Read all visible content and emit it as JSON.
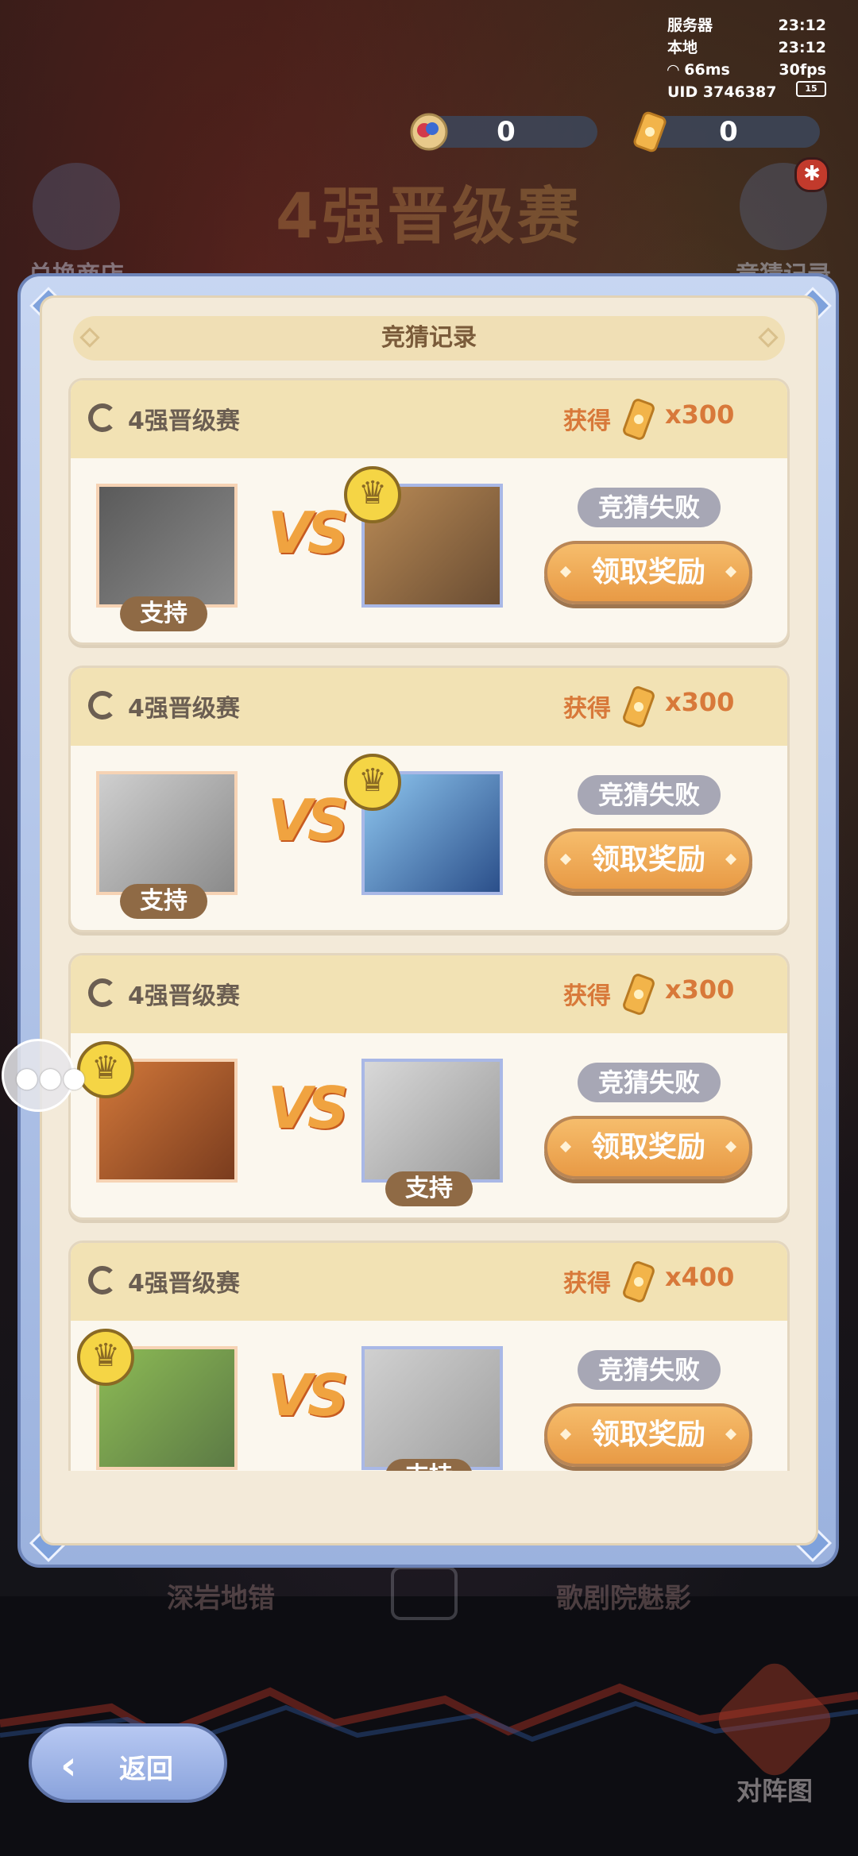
{
  "status_bar": {
    "server_label": "服务器",
    "server_time": "23:12",
    "local_label": "本地",
    "local_time": "23:12",
    "ping": "66ms",
    "fps": "30fps",
    "uid": "UID 3746387",
    "battery": "15"
  },
  "currencies": [
    {
      "icon": "gem-coin-icon",
      "value": "0"
    },
    {
      "icon": "ticket-icon",
      "value": "0"
    }
  ],
  "background": {
    "event_title": "4强晋级赛",
    "shop_label": "兑换商店",
    "guess_record_label": "竞猜记录",
    "bottom_left": "深岩地错",
    "bottom_right": "歌剧院魅影",
    "lineup_label": "对阵图"
  },
  "panel": {
    "title": "竞猜记录",
    "records": [
      {
        "match": "4强晋级赛",
        "gain_label": "获得",
        "gain_qty": "x300",
        "result": "竞猜失败",
        "claim": "领取奖励",
        "support": "支持",
        "support_side": "left",
        "winner_side": "right",
        "left_colors": [
          "#5a5a5a",
          "#8b8b8b"
        ],
        "right_colors": [
          "#b98a55",
          "#6a4d33"
        ]
      },
      {
        "match": "4强晋级赛",
        "gain_label": "获得",
        "gain_qty": "x300",
        "result": "竞猜失败",
        "claim": "领取奖励",
        "support": "支持",
        "support_side": "left",
        "winner_side": "right",
        "left_colors": [
          "#cfcfcf",
          "#8a8a8a"
        ],
        "right_colors": [
          "#8fc7f0",
          "#2b4f8a"
        ]
      },
      {
        "match": "4强晋级赛",
        "gain_label": "获得",
        "gain_qty": "x300",
        "result": "竞猜失败",
        "claim": "领取奖励",
        "support": "支持",
        "support_side": "right",
        "winner_side": "left",
        "left_colors": [
          "#d2783a",
          "#7a3c1e"
        ],
        "right_colors": [
          "#d8d8d8",
          "#9a9a9a"
        ]
      },
      {
        "match": "4强晋级赛",
        "gain_label": "获得",
        "gain_qty": "x400",
        "result": "竞猜失败",
        "claim": "领取奖励",
        "support": "支持",
        "support_side": "right",
        "winner_side": "left",
        "left_colors": [
          "#8dbb55",
          "#5c7a45"
        ],
        "right_colors": [
          "#d0d0d0",
          "#a0a0a0"
        ]
      }
    ]
  },
  "back_button": {
    "label": "返回"
  }
}
